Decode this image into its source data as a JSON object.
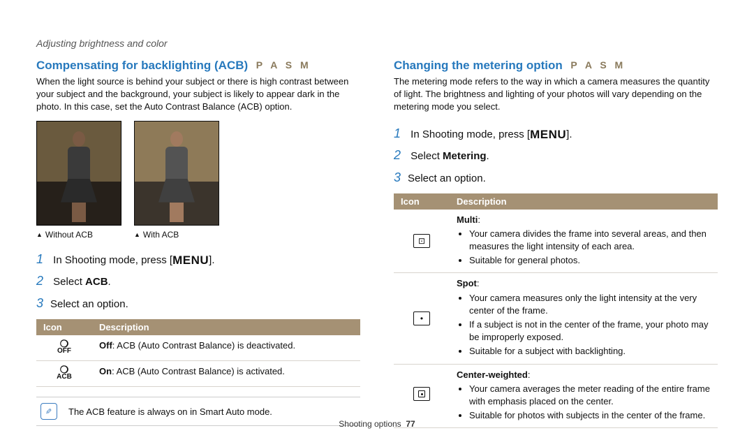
{
  "breadcrumb": "Adjusting brightness and color",
  "mode_key": "P A S M",
  "menu_button_label": "MENU",
  "table_headers": {
    "icon": "Icon",
    "description": "Description"
  },
  "footer": {
    "section": "Shooting options",
    "page": "77"
  },
  "left": {
    "title": "Compensating for backlighting (ACB)",
    "intro": "When the light source is behind your subject or there is high contrast between your subject and the background, your subject is likely to appear dark in the photo. In this case, set the Auto Contrast Balance (ACB) option.",
    "photos": [
      {
        "caption": "Without ACB"
      },
      {
        "caption": "With ACB"
      }
    ],
    "steps": {
      "s1_pre": "In Shooting mode, press [",
      "s1_post": "].",
      "s2_pre": "Select ",
      "s2_bold": "ACB",
      "s2_post": ".",
      "s3": "Select an option."
    },
    "options": [
      {
        "iconTop": "❍",
        "iconBot": "OFF",
        "bold": "Off",
        "text": ": ACB (Auto Contrast Balance) is deactivated."
      },
      {
        "iconTop": "❍",
        "iconBot": "ACB",
        "bold": "On",
        "text": ": ACB (Auto Contrast Balance) is activated."
      }
    ],
    "note": "The ACB feature is always on in Smart Auto mode."
  },
  "right": {
    "title": "Changing the metering option",
    "intro": "The metering mode refers to the way in which a camera measures the quantity of light. The brightness and lighting of your photos will vary depending on the metering mode you select.",
    "steps": {
      "s1_pre": "In Shooting mode, press [",
      "s1_post": "].",
      "s2_pre": "Select ",
      "s2_bold": "Metering",
      "s2_post": ".",
      "s3": "Select an option."
    },
    "options": [
      {
        "iconClass": "multi",
        "label": "Multi",
        "points": [
          "Your camera divides the frame into several areas, and then measures the light intensity of each area.",
          "Suitable for general photos."
        ]
      },
      {
        "iconClass": "spot",
        "label": "Spot",
        "points": [
          "Your camera measures only the light intensity at the very center of the frame.",
          "If a subject is not in the center of the frame, your photo may be improperly exposed.",
          "Suitable for a subject with backlighting."
        ]
      },
      {
        "iconClass": "center",
        "label": "Center-weighted",
        "points": [
          "Your camera averages the meter reading of the entire frame with emphasis placed on the center.",
          "Suitable for photos with subjects in the center of the frame."
        ]
      }
    ]
  }
}
